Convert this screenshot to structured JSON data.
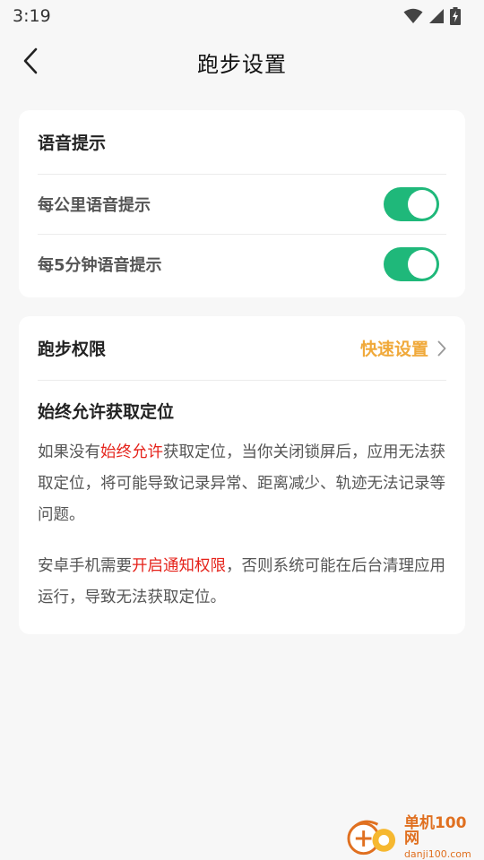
{
  "status_bar": {
    "time": "3:19"
  },
  "nav": {
    "title": "跑步设置"
  },
  "voice_card": {
    "title": "语音提示",
    "items": [
      {
        "label": "每公里语音提示",
        "enabled": true
      },
      {
        "label": "每5分钟语音提示",
        "enabled": true
      }
    ]
  },
  "permission_card": {
    "title": "跑步权限",
    "quick_setup_label": "快速设置",
    "subtitle": "始终允许获取定位",
    "para1": {
      "before": "如果没有",
      "highlight": "始终允许",
      "after": "获取定位，当你关闭锁屏后，应用无法获取定位，将可能导致记录异常、距离减少、轨迹无法记录等问题。"
    },
    "para2": {
      "before": "安卓手机需要",
      "highlight": "开启通知权限",
      "after": "，否则系统可能在后台清理应用运行，导致无法获取定位。"
    }
  },
  "watermark": {
    "name": "单机100网",
    "url": "danji100.com"
  },
  "colors": {
    "toggle_on": "#1fb87a",
    "accent_orange": "#f0a93a",
    "highlight_red": "#e5231b",
    "background": "#f7f7f7"
  }
}
